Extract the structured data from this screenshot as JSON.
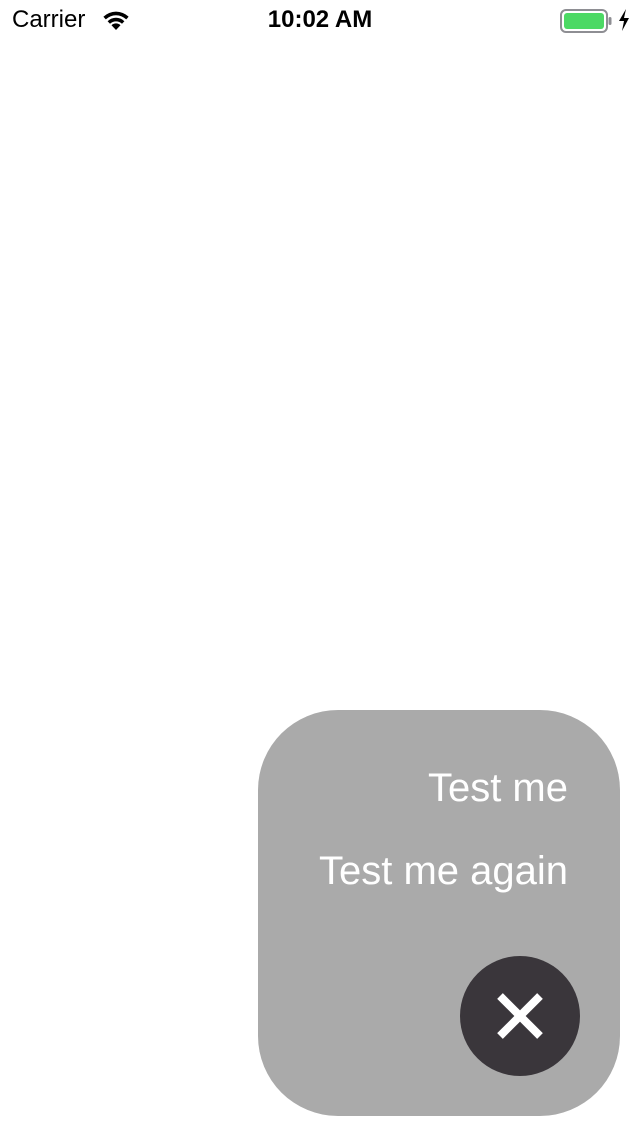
{
  "status_bar": {
    "carrier": "Carrier",
    "time": "10:02 AM",
    "icons": [
      "wifi-icon",
      "battery-icon",
      "charging-bolt-icon"
    ],
    "battery_color": "#4cd964",
    "battery_level": 1.0
  },
  "menu": {
    "items": [
      {
        "label": "Test me"
      },
      {
        "label": "Test me again"
      }
    ],
    "close_icon": "close-icon",
    "panel_color": "#aaaaaa",
    "close_button_color": "#3a363b",
    "text_color": "#ffffff"
  }
}
